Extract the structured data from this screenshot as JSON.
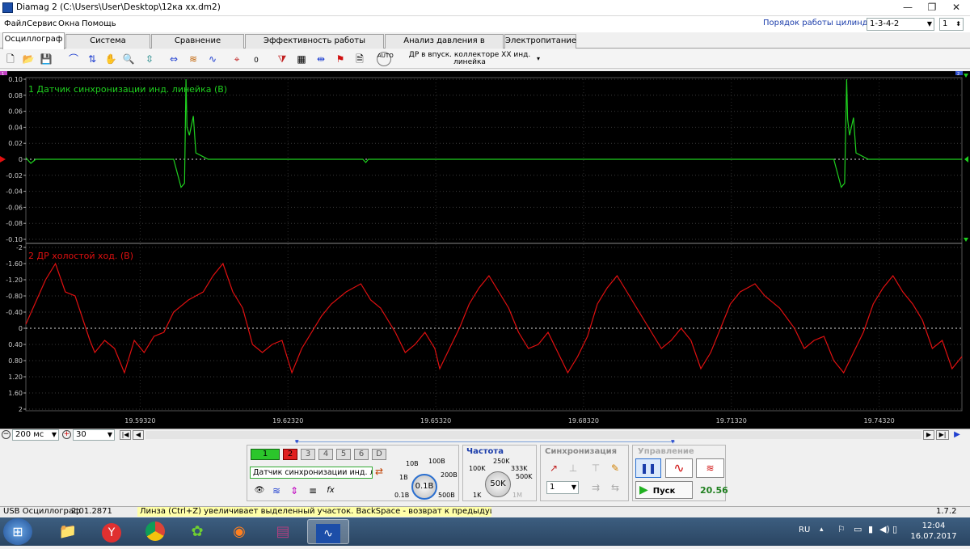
{
  "window": {
    "title": "Diamag 2 (C:\\Users\\User\\Desktop\\12ка хх.dm2)",
    "minimize": "—",
    "maximize": "❐",
    "close": "✕"
  },
  "menu": [
    "Файл",
    "Сервис",
    "Окна",
    "Помощь"
  ],
  "cylinder_order": {
    "label": "Порядок работы цилиндров",
    "value": "1-3-4-2",
    "count": "1"
  },
  "tabs": [
    "Осциллограф",
    "Система зажигания",
    "Сравнение цилиндров",
    "Эффективность работы цилиндров",
    "Анализ давления в цилиндре",
    "Электропитание"
  ],
  "active_tab": 0,
  "toolbar": {
    "dr_select": "ДР в впуск. коллекторе ХХ инд. линейка",
    "auto_label": "AUTO",
    "scale_label": "0"
  },
  "scope": {
    "channel1": {
      "label": "1 Датчик синхронизации инд. линейка (В)",
      "color": "#1fd01f",
      "ticks": [
        "0.10",
        "0.08",
        "0.06",
        "0.04",
        "0.02",
        "0",
        "-0.02",
        "-0.04",
        "-0.06",
        "-0.08",
        "-0.10"
      ]
    },
    "channel2": {
      "label": "2 ДР холостой ход. (В)",
      "color": "#e01010",
      "ticks": [
        "-2",
        "-1.60",
        "-1.20",
        "-0.80",
        "-0.40",
        "0",
        "0.40",
        "0.80",
        "1.20",
        "1.60",
        "2"
      ]
    },
    "time_ticks": [
      "19.59320",
      "19.62320",
      "19.65320",
      "19.68320",
      "19.71320",
      "19.74320"
    ],
    "marker1": "1",
    "marker2": "2"
  },
  "chart_data": {
    "type": "line",
    "x_unit": "s",
    "x_range": [
      19.57,
      19.76
    ],
    "series": [
      {
        "name": "1 Датчик синхронизации инд. линейка (В)",
        "color": "#1fd01f",
        "ylim": [
          -0.1,
          0.1
        ],
        "points": [
          [
            19.57,
            0.002
          ],
          [
            19.571,
            -0.005
          ],
          [
            19.572,
            0.0
          ],
          [
            19.6,
            0.0
          ],
          [
            19.6015,
            -0.035
          ],
          [
            19.6022,
            -0.03
          ],
          [
            19.6025,
            0.1
          ],
          [
            19.6027,
            0.04
          ],
          [
            19.6032,
            0.03
          ],
          [
            19.604,
            0.054
          ],
          [
            19.6045,
            0.008
          ],
          [
            19.607,
            0.0
          ],
          [
            19.6384,
            0.0
          ],
          [
            19.639,
            -0.004
          ],
          [
            19.6395,
            0.0
          ],
          [
            19.734,
            0.0
          ],
          [
            19.7355,
            -0.035
          ],
          [
            19.7362,
            -0.03
          ],
          [
            19.7366,
            0.1
          ],
          [
            19.7368,
            0.05
          ],
          [
            19.7372,
            0.03
          ],
          [
            19.738,
            0.052
          ],
          [
            19.7385,
            0.008
          ],
          [
            19.741,
            0.0
          ],
          [
            19.76,
            0.0
          ]
        ]
      },
      {
        "name": "2 ДР холостой ход. (В)",
        "color": "#e01010",
        "ylim": [
          -2,
          2
        ],
        "points": [
          [
            19.57,
            -0.1
          ],
          [
            19.574,
            -1.2
          ],
          [
            19.576,
            -1.6
          ],
          [
            19.578,
            -0.9
          ],
          [
            19.58,
            -0.8
          ],
          [
            19.583,
            0.3
          ],
          [
            19.584,
            0.6
          ],
          [
            19.586,
            0.3
          ],
          [
            19.588,
            0.5
          ],
          [
            19.59,
            1.1
          ],
          [
            19.592,
            0.3
          ],
          [
            19.594,
            0.6
          ],
          [
            19.596,
            0.2
          ],
          [
            19.598,
            0.1
          ],
          [
            19.6,
            -0.4
          ],
          [
            19.603,
            -0.7
          ],
          [
            19.606,
            -0.9
          ],
          [
            19.608,
            -1.3
          ],
          [
            19.61,
            -1.6
          ],
          [
            19.612,
            -0.9
          ],
          [
            19.614,
            -0.5
          ],
          [
            19.616,
            0.4
          ],
          [
            19.618,
            0.6
          ],
          [
            19.62,
            0.4
          ],
          [
            19.622,
            0.3
          ],
          [
            19.624,
            1.1
          ],
          [
            19.626,
            0.5
          ],
          [
            19.628,
            0.1
          ],
          [
            19.63,
            -0.3
          ],
          [
            19.632,
            -0.6
          ],
          [
            19.635,
            -0.9
          ],
          [
            19.638,
            -1.1
          ],
          [
            19.64,
            -0.7
          ],
          [
            19.642,
            -0.5
          ],
          [
            19.645,
            0.1
          ],
          [
            19.647,
            0.6
          ],
          [
            19.649,
            0.4
          ],
          [
            19.651,
            0.1
          ],
          [
            19.653,
            0.5
          ],
          [
            19.654,
            1.0
          ],
          [
            19.656,
            0.5
          ],
          [
            19.658,
            0.0
          ],
          [
            19.66,
            -0.6
          ],
          [
            19.662,
            -1.0
          ],
          [
            19.664,
            -1.3
          ],
          [
            19.666,
            -0.9
          ],
          [
            19.668,
            -0.5
          ],
          [
            19.67,
            0.1
          ],
          [
            19.672,
            0.5
          ],
          [
            19.674,
            0.4
          ],
          [
            19.676,
            0.1
          ],
          [
            19.678,
            0.6
          ],
          [
            19.68,
            1.1
          ],
          [
            19.682,
            0.7
          ],
          [
            19.684,
            0.2
          ],
          [
            19.686,
            -0.6
          ],
          [
            19.688,
            -1.0
          ],
          [
            19.69,
            -1.3
          ],
          [
            19.692,
            -0.9
          ],
          [
            19.694,
            -0.5
          ],
          [
            19.697,
            0.1
          ],
          [
            19.699,
            0.5
          ],
          [
            19.701,
            0.3
          ],
          [
            19.703,
            0.0
          ],
          [
            19.705,
            0.3
          ],
          [
            19.707,
            1.0
          ],
          [
            19.709,
            0.6
          ],
          [
            19.711,
            0.0
          ],
          [
            19.713,
            -0.6
          ],
          [
            19.715,
            -0.9
          ],
          [
            19.718,
            -1.1
          ],
          [
            19.72,
            -0.8
          ],
          [
            19.723,
            -0.5
          ],
          [
            19.726,
            0.0
          ],
          [
            19.728,
            0.5
          ],
          [
            19.73,
            0.3
          ],
          [
            19.732,
            0.2
          ],
          [
            19.734,
            0.8
          ],
          [
            19.736,
            1.1
          ],
          [
            19.738,
            0.6
          ],
          [
            19.74,
            0.1
          ],
          [
            19.742,
            -0.6
          ],
          [
            19.744,
            -1.0
          ],
          [
            19.746,
            -1.3
          ],
          [
            19.748,
            -0.9
          ],
          [
            19.75,
            -0.6
          ],
          [
            19.752,
            -0.2
          ],
          [
            19.754,
            0.5
          ],
          [
            19.756,
            0.3
          ],
          [
            19.758,
            1.0
          ],
          [
            19.76,
            0.7
          ]
        ]
      }
    ]
  },
  "bottom_controls": {
    "time_per_div": "200 мс",
    "zoom": "30"
  },
  "channels": [
    "1",
    "2",
    "3",
    "4",
    "5",
    "6",
    "D"
  ],
  "channel_name": "Датчик синхронизации инд. ли...",
  "voltage_dial": {
    "labels": [
      "10В",
      "100В",
      "1В",
      "200В",
      "0.1В",
      "500В"
    ],
    "value": "0.1В"
  },
  "frequency": {
    "title": "Частота",
    "labels": [
      "250K",
      "100K",
      "333K",
      "500K",
      "1K",
      "1M"
    ],
    "value": "50K"
  },
  "sync": {
    "title": "Синхронизация",
    "channel": "1"
  },
  "control": {
    "title": "Управление",
    "start": "Пуск",
    "value": "20.56"
  },
  "status": {
    "device": "USB Осциллограф",
    "version": "2.01.2871",
    "hint": "Линза (Ctrl+Z) увеличивает выделенный участок. BackSpace - возврат к предыдущему виду.",
    "right": "1.7.2"
  },
  "taskbar": {
    "lang": "RU",
    "time": "12:04",
    "date": "16.07.2017"
  }
}
